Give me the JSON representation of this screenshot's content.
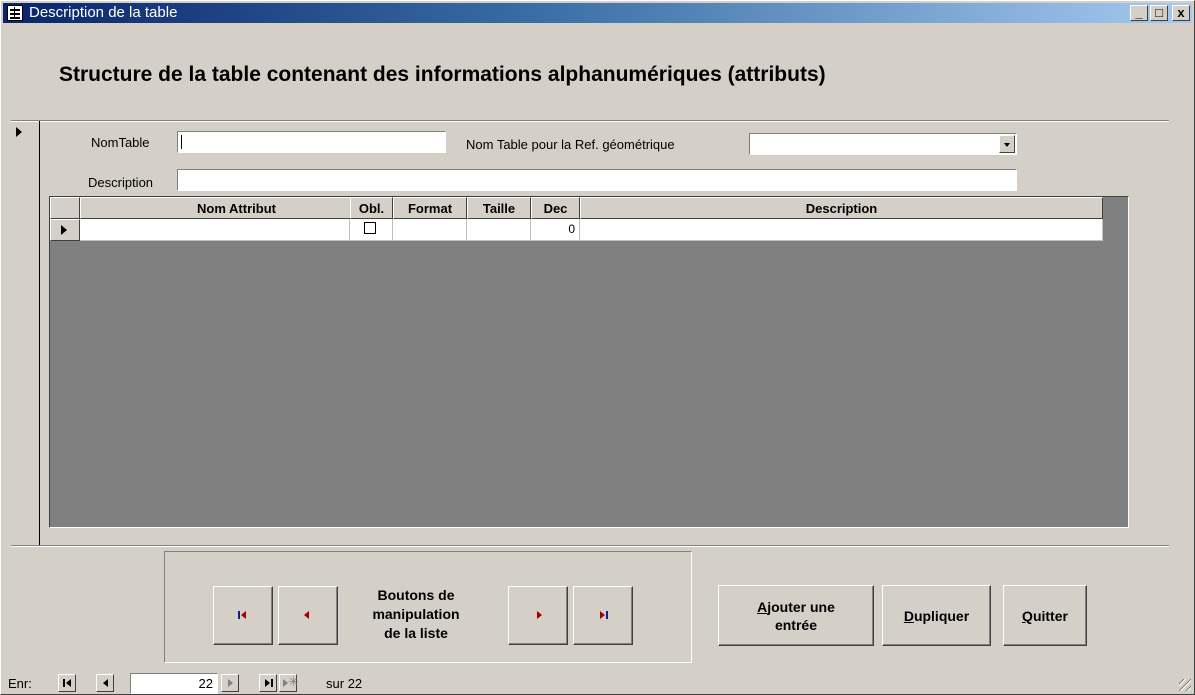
{
  "window": {
    "title": "Description de la table",
    "controls": {
      "minimize": "_",
      "maximize": "□",
      "close": "x"
    }
  },
  "heading": "Structure de la table contenant des informations alphanumériques (attributs)",
  "form": {
    "nomtable_label": "NomTable",
    "nomtable_value": "",
    "ref_geo_label": "Nom Table pour la Ref. géométrique",
    "ref_geo_value": "",
    "description_label": "Description",
    "description_value": ""
  },
  "grid": {
    "columns": [
      "Nom Attribut",
      "Obl.",
      "Format",
      "Taille",
      "Dec",
      "Description"
    ],
    "rows": [
      {
        "nom_attribut": "",
        "obl": false,
        "format": "",
        "taille": "",
        "dec": "0",
        "description": ""
      }
    ]
  },
  "buttons": {
    "nav_caption": "Boutons de manipulation de la liste",
    "nav_caption_lines": [
      "Boutons de",
      "manipulation",
      "de la liste"
    ],
    "add_entry_lines": [
      "Ajouter une",
      "entrée"
    ],
    "add_entry_accel": "A",
    "add_entry_rest": "jouter une",
    "duplicate_accel": "D",
    "duplicate_rest": "upliquer",
    "quit_accel": "Q",
    "quit_rest": "uitter"
  },
  "record_navigator": {
    "label": "Enr:",
    "current": "22",
    "of_label": "sur",
    "total": "22"
  },
  "colors": {
    "face": "#d4d0c8",
    "title_start": "#0a246a",
    "title_end": "#a6caf0",
    "grid_bg": "#808080",
    "nav_arrow": "#a00000",
    "nav_bar": "#1a1a8c"
  }
}
